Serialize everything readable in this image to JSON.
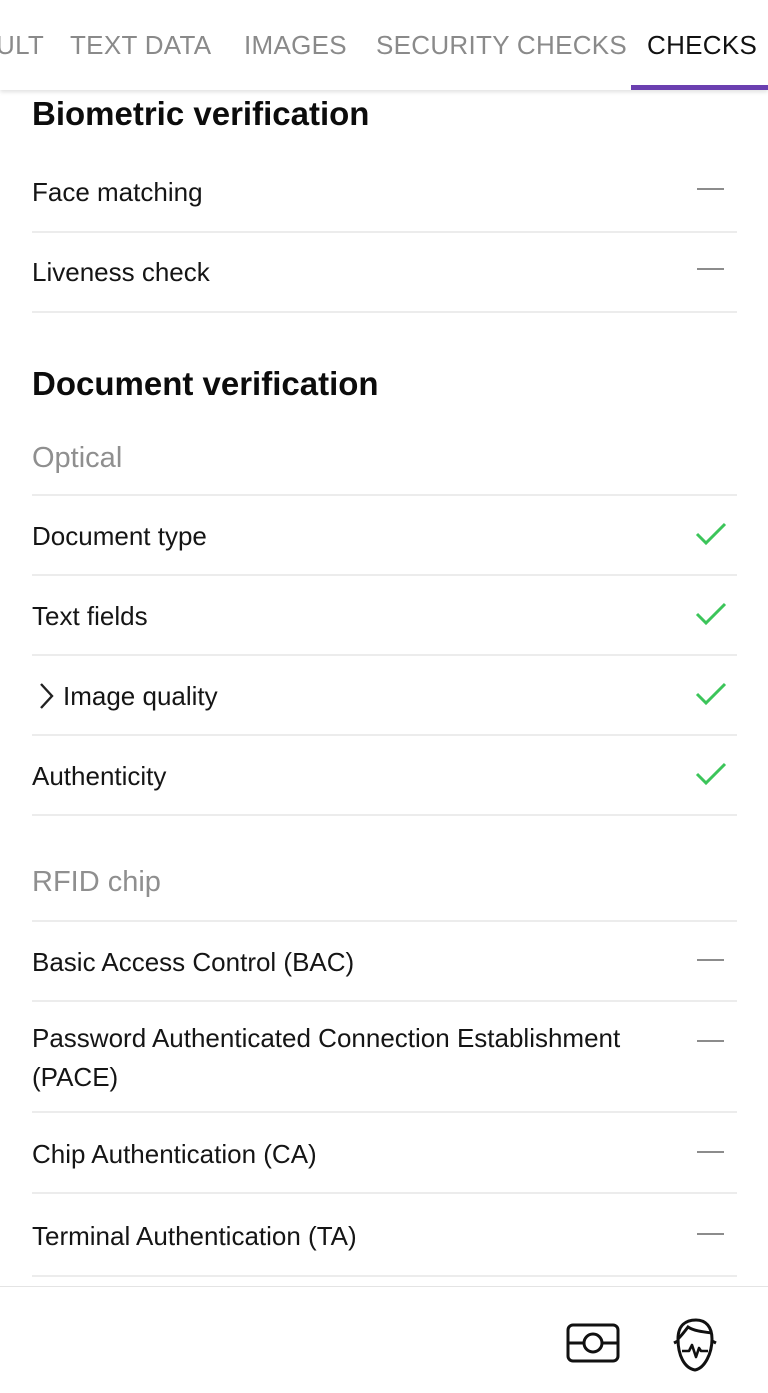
{
  "tabs": [
    {
      "label": "ULT",
      "active": false
    },
    {
      "label": "TEXT DATA",
      "active": false
    },
    {
      "label": "IMAGES",
      "active": false
    },
    {
      "label": "SECURITY CHECKS",
      "active": false
    },
    {
      "label": "CHECKS",
      "active": true
    }
  ],
  "accent_color": "#6b3fb0",
  "success_color": "#3cc55a",
  "biometric": {
    "title": "Biometric verification",
    "items": [
      {
        "label": "Face matching",
        "status": "none"
      },
      {
        "label": "Liveness check",
        "status": "none"
      }
    ]
  },
  "document": {
    "title": "Document verification",
    "optical": {
      "title": "Optical",
      "items": [
        {
          "label": "Document type",
          "status": "passed"
        },
        {
          "label": "Text fields",
          "status": "passed"
        },
        {
          "label": "Image quality",
          "status": "passed",
          "expandable": true
        },
        {
          "label": "Authenticity",
          "status": "passed"
        }
      ]
    },
    "rfid": {
      "title": "RFID chip",
      "items": [
        {
          "label": "Basic Access Control (BAC)",
          "status": "none"
        },
        {
          "label": "Password Authenticated Connection Establishment (PACE)",
          "status": "none"
        },
        {
          "label": "Chip Authentication (CA)",
          "status": "none"
        },
        {
          "label": "Terminal Authentication (TA)",
          "status": "none"
        }
      ]
    }
  },
  "bottom_bar": {
    "icons": [
      "document-scan-icon",
      "face-liveness-icon"
    ]
  }
}
